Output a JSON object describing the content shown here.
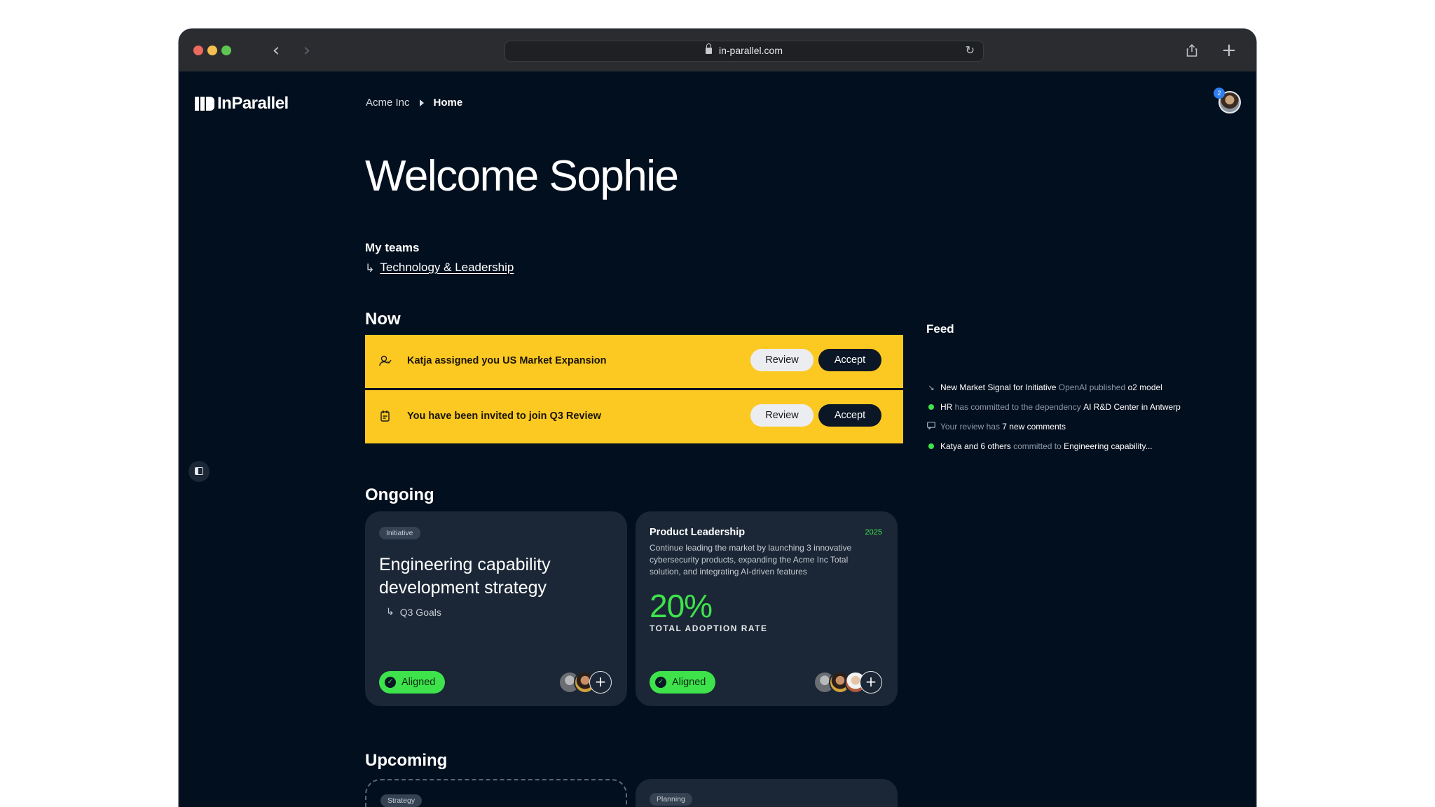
{
  "browser": {
    "url": "in-parallel.com",
    "back_icon": "‹",
    "forward_icon": "›",
    "share_icon": "share-icon",
    "newtab_icon": "+",
    "reload_icon": "↻"
  },
  "app": {
    "logo_text": "InParallel",
    "breadcrumb": [
      "Acme Inc",
      "Home"
    ],
    "notification_count": "2"
  },
  "welcome": "Welcome Sophie",
  "my_teams": {
    "label": "My teams",
    "arrow": "↳",
    "team": "Technology & Leadership"
  },
  "now": {
    "title": "Now",
    "items": [
      {
        "icon": "person-assign-icon",
        "text": "Katja assigned you US Market Expansion",
        "review": "Review",
        "accept": "Accept"
      },
      {
        "icon": "calendar-invite-icon",
        "text": "You have been invited to join Q3 Review",
        "review": "Review",
        "accept": "Accept"
      }
    ]
  },
  "ongoing": {
    "title": "Ongoing",
    "card1": {
      "tag": "Initiative",
      "title": "Engineering capability development strategy",
      "arrow": "↳",
      "sub": "Q3 Goals",
      "status": "Aligned"
    },
    "card2": {
      "title": "Product Leadership",
      "year": "2025",
      "description": "Continue leading the market by launching 3 innovative cybersecurity products, expanding the Acme Inc Total solution, and integrating AI-driven features",
      "percent": "20%",
      "metric_label": "TOTAL ADOPTION RATE",
      "status": "Aligned"
    },
    "add_icon": "+"
  },
  "feed": {
    "title": "Feed",
    "items": [
      {
        "icon": "↘",
        "a": "New Market Signal for Initiative",
        "b": " OpenAI published ",
        "c": "o2 model"
      },
      {
        "icon": "dot",
        "a": "HR",
        "b": " has committed to the dependency ",
        "c": "AI R&D Center in Antwerp"
      },
      {
        "icon": "comment-icon",
        "a": "",
        "b": "Your review has ",
        "c": "7 new comments"
      },
      {
        "icon": "dot",
        "a": "Katya and 6 others",
        "b": " committed to ",
        "c": "Engineering capability..."
      }
    ]
  },
  "upcoming": {
    "title": "Upcoming",
    "tags": [
      "Strategy",
      "Planning"
    ]
  },
  "colors": {
    "background": "#020f1e",
    "card": "#1b2736",
    "accent_yellow": "#fcc923",
    "accent_green": "#3ee34c"
  }
}
